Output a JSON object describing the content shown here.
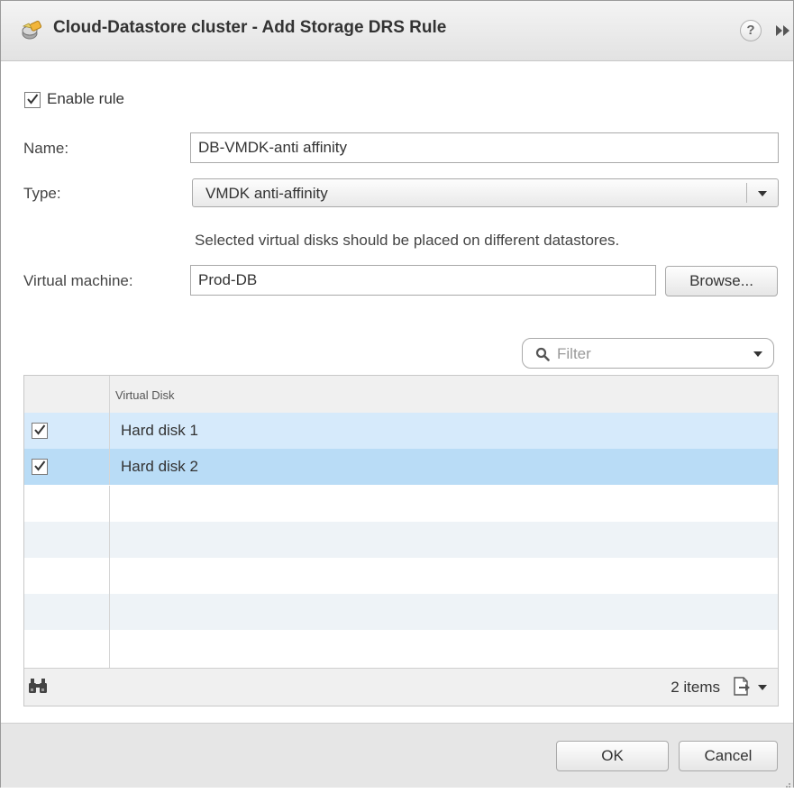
{
  "dialog": {
    "title": "Cloud-Datastore cluster - Add Storage DRS Rule",
    "help_glyph": "?",
    "title_icon": "storage-cluster-icon",
    "expand_icon": "double-chevron-right-icon"
  },
  "form": {
    "enable_rule_label": "Enable rule",
    "enable_rule_checked": true,
    "name_label": "Name:",
    "name_value": "DB-VMDK-anti affinity",
    "type_label": "Type:",
    "type_value": "VMDK anti-affinity",
    "type_description": "Selected virtual disks should be placed on different datastores.",
    "vm_label": "Virtual machine:",
    "vm_value": "Prod-DB",
    "browse_label": "Browse..."
  },
  "filter": {
    "placeholder": "Filter",
    "icon": "search-icon"
  },
  "grid": {
    "column_header": "Virtual Disk",
    "rows": [
      {
        "label": "Hard disk 1",
        "checked": true
      },
      {
        "label": "Hard disk 2",
        "checked": true
      }
    ],
    "item_count": "2 items",
    "footer_icons": [
      "binoculars-icon",
      "export-icon"
    ]
  },
  "buttons": {
    "ok_label": "OK",
    "cancel_label": "Cancel"
  },
  "colors": {
    "row_selected_1": "#d6eafb",
    "row_selected_2": "#b9dcf6",
    "row_alt": "#eef3f7"
  }
}
